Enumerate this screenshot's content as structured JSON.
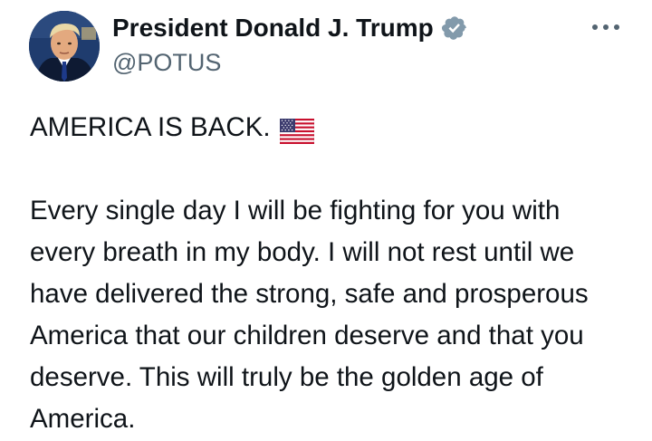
{
  "tweet": {
    "author": {
      "display_name": "President Donald J. Trump",
      "handle": "@POTUS",
      "verified": true,
      "verified_icon": "verified-badge-icon",
      "verified_color": "#829aab"
    },
    "more_icon": "more-options-icon",
    "headline": "AMERICA IS BACK.",
    "headline_emoji": "us-flag-icon",
    "body": "Every single day I will be fighting for you with every breath in my body. I will not rest until we have delivered the strong, safe and prosperous America that our children deserve and that you deserve. This will truly be the golden age of America."
  },
  "colors": {
    "text": "#0f1419",
    "secondary_text": "#536471",
    "background": "#ffffff"
  }
}
